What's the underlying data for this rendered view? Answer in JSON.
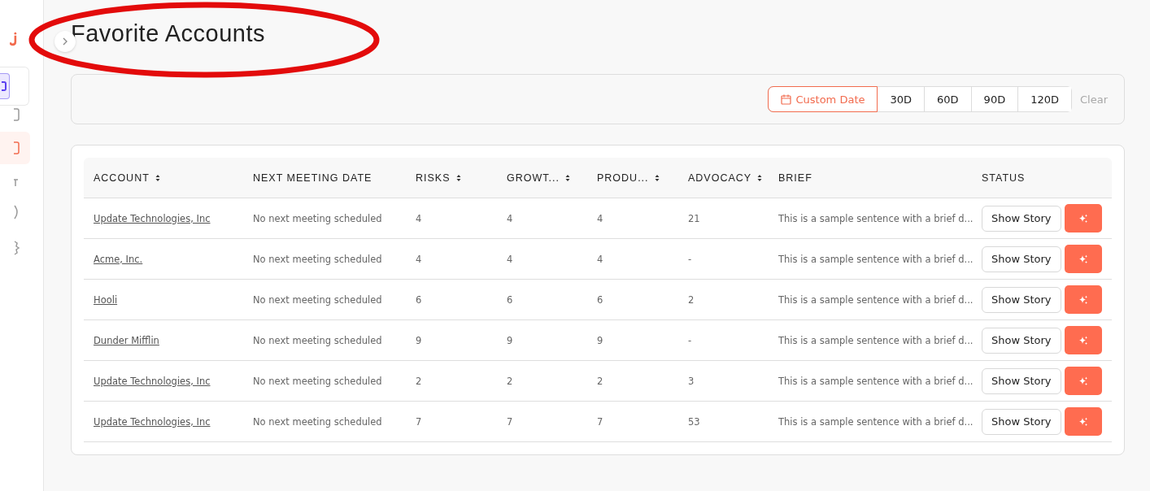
{
  "page": {
    "title": "Favorite Accounts"
  },
  "annotation": {
    "kind": "ellipse"
  },
  "date_filter": {
    "options": [
      {
        "label": "Custom Date",
        "kind": "calendar",
        "selected": true
      },
      {
        "label": "30D",
        "kind": "plain",
        "selected": false
      },
      {
        "label": "60D",
        "kind": "plain",
        "selected": false
      },
      {
        "label": "90D",
        "kind": "plain",
        "selected": false
      },
      {
        "label": "120D",
        "kind": "plain",
        "selected": false
      }
    ],
    "clear": {
      "label": "Clear",
      "disabled": true
    }
  },
  "table": {
    "columns": [
      {
        "label": "ACCOUNT",
        "sortable": true
      },
      {
        "label": "NEXT MEETING DATE",
        "sortable": false
      },
      {
        "label": "RISKS",
        "sortable": true
      },
      {
        "label": "GROWT...",
        "sortable": true
      },
      {
        "label": "PRODU...",
        "sortable": true
      },
      {
        "label": "ADVOCACY",
        "sortable": true
      },
      {
        "label": "BRIEF",
        "sortable": false
      },
      {
        "label": "STATUS",
        "sortable": false
      }
    ],
    "rows": [
      {
        "account": "Update Technologies, Inc",
        "next_meeting": "No next meeting scheduled",
        "risks": "4",
        "growth": "4",
        "product": "4",
        "advocacy": "21",
        "brief": "This is a sample sentence with a brief d...",
        "action": "Show Story"
      },
      {
        "account": "Acme, Inc.",
        "next_meeting": "No next meeting scheduled",
        "risks": "4",
        "growth": "4",
        "product": "4",
        "advocacy": "-",
        "brief": "This is a sample sentence with a brief d...",
        "action": "Show Story"
      },
      {
        "account": "Hooli",
        "next_meeting": "No next meeting scheduled",
        "risks": "6",
        "growth": "6",
        "product": "6",
        "advocacy": "2",
        "brief": "This is a sample sentence with a brief d...",
        "action": "Show Story"
      },
      {
        "account": "Dunder Mifflin",
        "next_meeting": "No next meeting scheduled",
        "risks": "9",
        "growth": "9",
        "product": "9",
        "advocacy": "-",
        "brief": "This is a sample sentence with a brief d...",
        "action": "Show Story"
      },
      {
        "account": "Update Technologies, Inc",
        "next_meeting": "No next meeting scheduled",
        "risks": "2",
        "growth": "2",
        "product": "2",
        "advocacy": "3",
        "brief": "This is a sample sentence with a brief d...",
        "action": "Show Story"
      },
      {
        "account": "Update Technologies, Inc",
        "next_meeting": "No next meeting scheduled",
        "risks": "7",
        "growth": "7",
        "product": "7",
        "advocacy": "53",
        "brief": "This is a sample sentence with a brief d...",
        "action": "Show Story"
      }
    ]
  }
}
